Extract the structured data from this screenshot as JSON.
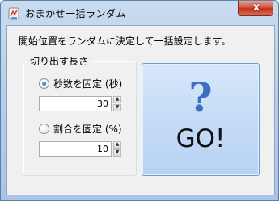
{
  "window": {
    "title": "おまかせ一括ランダム",
    "close_symbol": "x"
  },
  "instruction": "開始位置をランダムに決定して一括設定します。",
  "group": {
    "label": "切り出す長さ",
    "options": [
      {
        "label": "秒数を固定 (秒)",
        "value": "30",
        "selected": true
      },
      {
        "label": "割合を固定 (%)",
        "value": "10",
        "selected": false
      }
    ]
  },
  "go_button": {
    "icon": "question-mark-icon",
    "icon_glyph": "?",
    "label": "GO!"
  },
  "colors": {
    "accent": "#3f6fc2",
    "close_button": "#c0311a"
  }
}
